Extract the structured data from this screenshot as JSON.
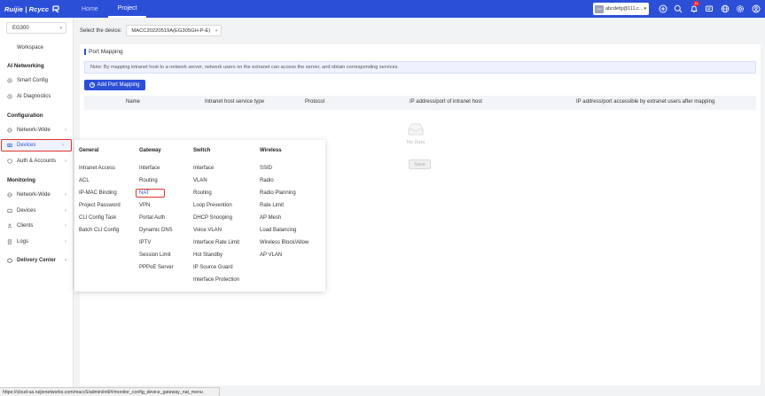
{
  "brand": {
    "logo_text": "Ruijie | Rcycc",
    "accent": "#2c4fd8",
    "alert": "#e0332b"
  },
  "nav": [
    {
      "label": "Home"
    },
    {
      "label": "Project"
    }
  ],
  "account": {
    "avatar_label": "user",
    "name": "abcdefg@111.c..."
  },
  "top_icons": [
    {
      "icon": "plus-circle-icon"
    },
    {
      "icon": "search-icon"
    },
    {
      "icon": "bell-icon",
      "badge": "11"
    },
    {
      "icon": "message-icon"
    },
    {
      "icon": "globe-icon"
    },
    {
      "icon": "gear-icon"
    },
    {
      "icon": "user-icon"
    }
  ],
  "sidebar": {
    "project": "EG300",
    "workspace": "Workspace",
    "sections": {
      "ai_networking": "AI Networking",
      "configuration": "Configuration",
      "monitoring": "Monitoring"
    },
    "items": {
      "smart_config": "Smart Config",
      "ai_diagnostics": "AI Diagnostics",
      "network_wide": "Network-Wide",
      "devices": "Devices",
      "auth_accounts": "Auth & Accounts",
      "mon_network_wide": "Network-Wide",
      "mon_devices": "Devices",
      "clients": "Clients",
      "logs": "Logs",
      "delivery_center": "Delivery Center"
    }
  },
  "device_bar": {
    "label": "Select the device:",
    "value": "MACC20220519A(EG305GH-P-E)"
  },
  "panel": {
    "title": "Port Mapping",
    "note": "Note: By mapping intranet host to a network server, network users on the extranet can access the server, and obtain corresponding services.",
    "add_button": "Add Port Mapping",
    "columns": [
      "Name",
      "Intranet host service type",
      "Protocol",
      "IP address/port of intranet host",
      "IP address/port accessible by extranet users after mapping"
    ],
    "empty_text": "No Data",
    "save_button": "Save"
  },
  "megamenu": {
    "columns": [
      {
        "title": "General",
        "items": [
          "Intranet Access",
          "ACL",
          "IP-MAC Binding",
          "Project Password",
          "CLI Config Task",
          "Batch CLI Config"
        ]
      },
      {
        "title": "Gateway",
        "items": [
          "Interface",
          "Routing",
          "NAT",
          "VPN",
          "Portal Auth",
          "Dynamic DNS",
          "IPTV",
          "Session Limit",
          "PPPoE Server"
        ]
      },
      {
        "title": "Switch",
        "items": [
          "Interface",
          "VLAN",
          "Routing",
          "Loop Prevention",
          "DHCP Snooping",
          "Voice VLAN",
          "Interface Rate Limit",
          "Hot Standby",
          "IP Source Guard",
          "Interface Protection"
        ]
      },
      {
        "title": "Wireless",
        "items": [
          "SSID",
          "Radio",
          "Radio Planning",
          "Rate Limit",
          "AP Mesh",
          "Load Balancing",
          "Wireless Block/Allow",
          "AP VLAN"
        ]
      }
    ]
  },
  "status_url": "https://cloud-as.ruijienetworks.com/macc5/admin/intl/#/monitor_config_device_gateway_nat_menu"
}
